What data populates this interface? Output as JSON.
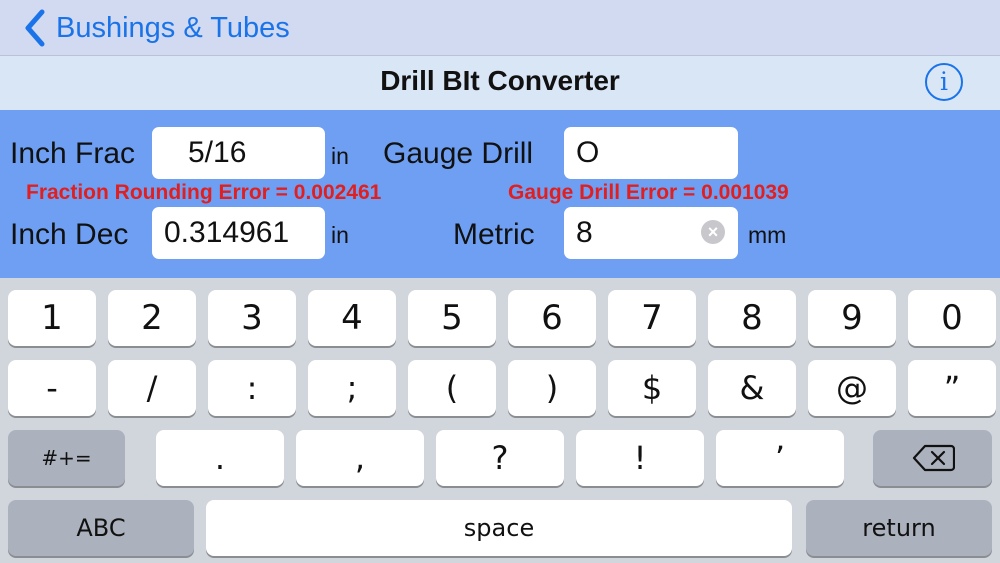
{
  "nav": {
    "back_label": "Bushings & Tubes"
  },
  "header": {
    "title": "Drill BIt Converter",
    "info_glyph": "i"
  },
  "form": {
    "inch_frac": {
      "label": "Inch Frac",
      "value": "5/16",
      "unit": "in"
    },
    "gauge_drill": {
      "label": "Gauge Drill",
      "value": "O"
    },
    "fraction_error": "Fraction Rounding Error = 0.002461",
    "gauge_error": "Gauge Drill Error = 0.001039",
    "inch_dec": {
      "label": "Inch Dec",
      "value": "0.314961",
      "unit": "in"
    },
    "metric": {
      "label": "Metric",
      "value": "8",
      "unit": "mm"
    }
  },
  "keyboard": {
    "row1": [
      "1",
      "2",
      "3",
      "4",
      "5",
      "6",
      "7",
      "8",
      "9",
      "0"
    ],
    "row2": [
      "-",
      "/",
      ":",
      ";",
      "(",
      ")",
      "$",
      "&",
      "@",
      "”"
    ],
    "row3": {
      "shift": "#+=",
      "keys": [
        ".",
        ",",
        "?",
        "!",
        "’"
      ]
    },
    "row4": {
      "abc": "ABC",
      "space": "space",
      "return": "return"
    }
  }
}
